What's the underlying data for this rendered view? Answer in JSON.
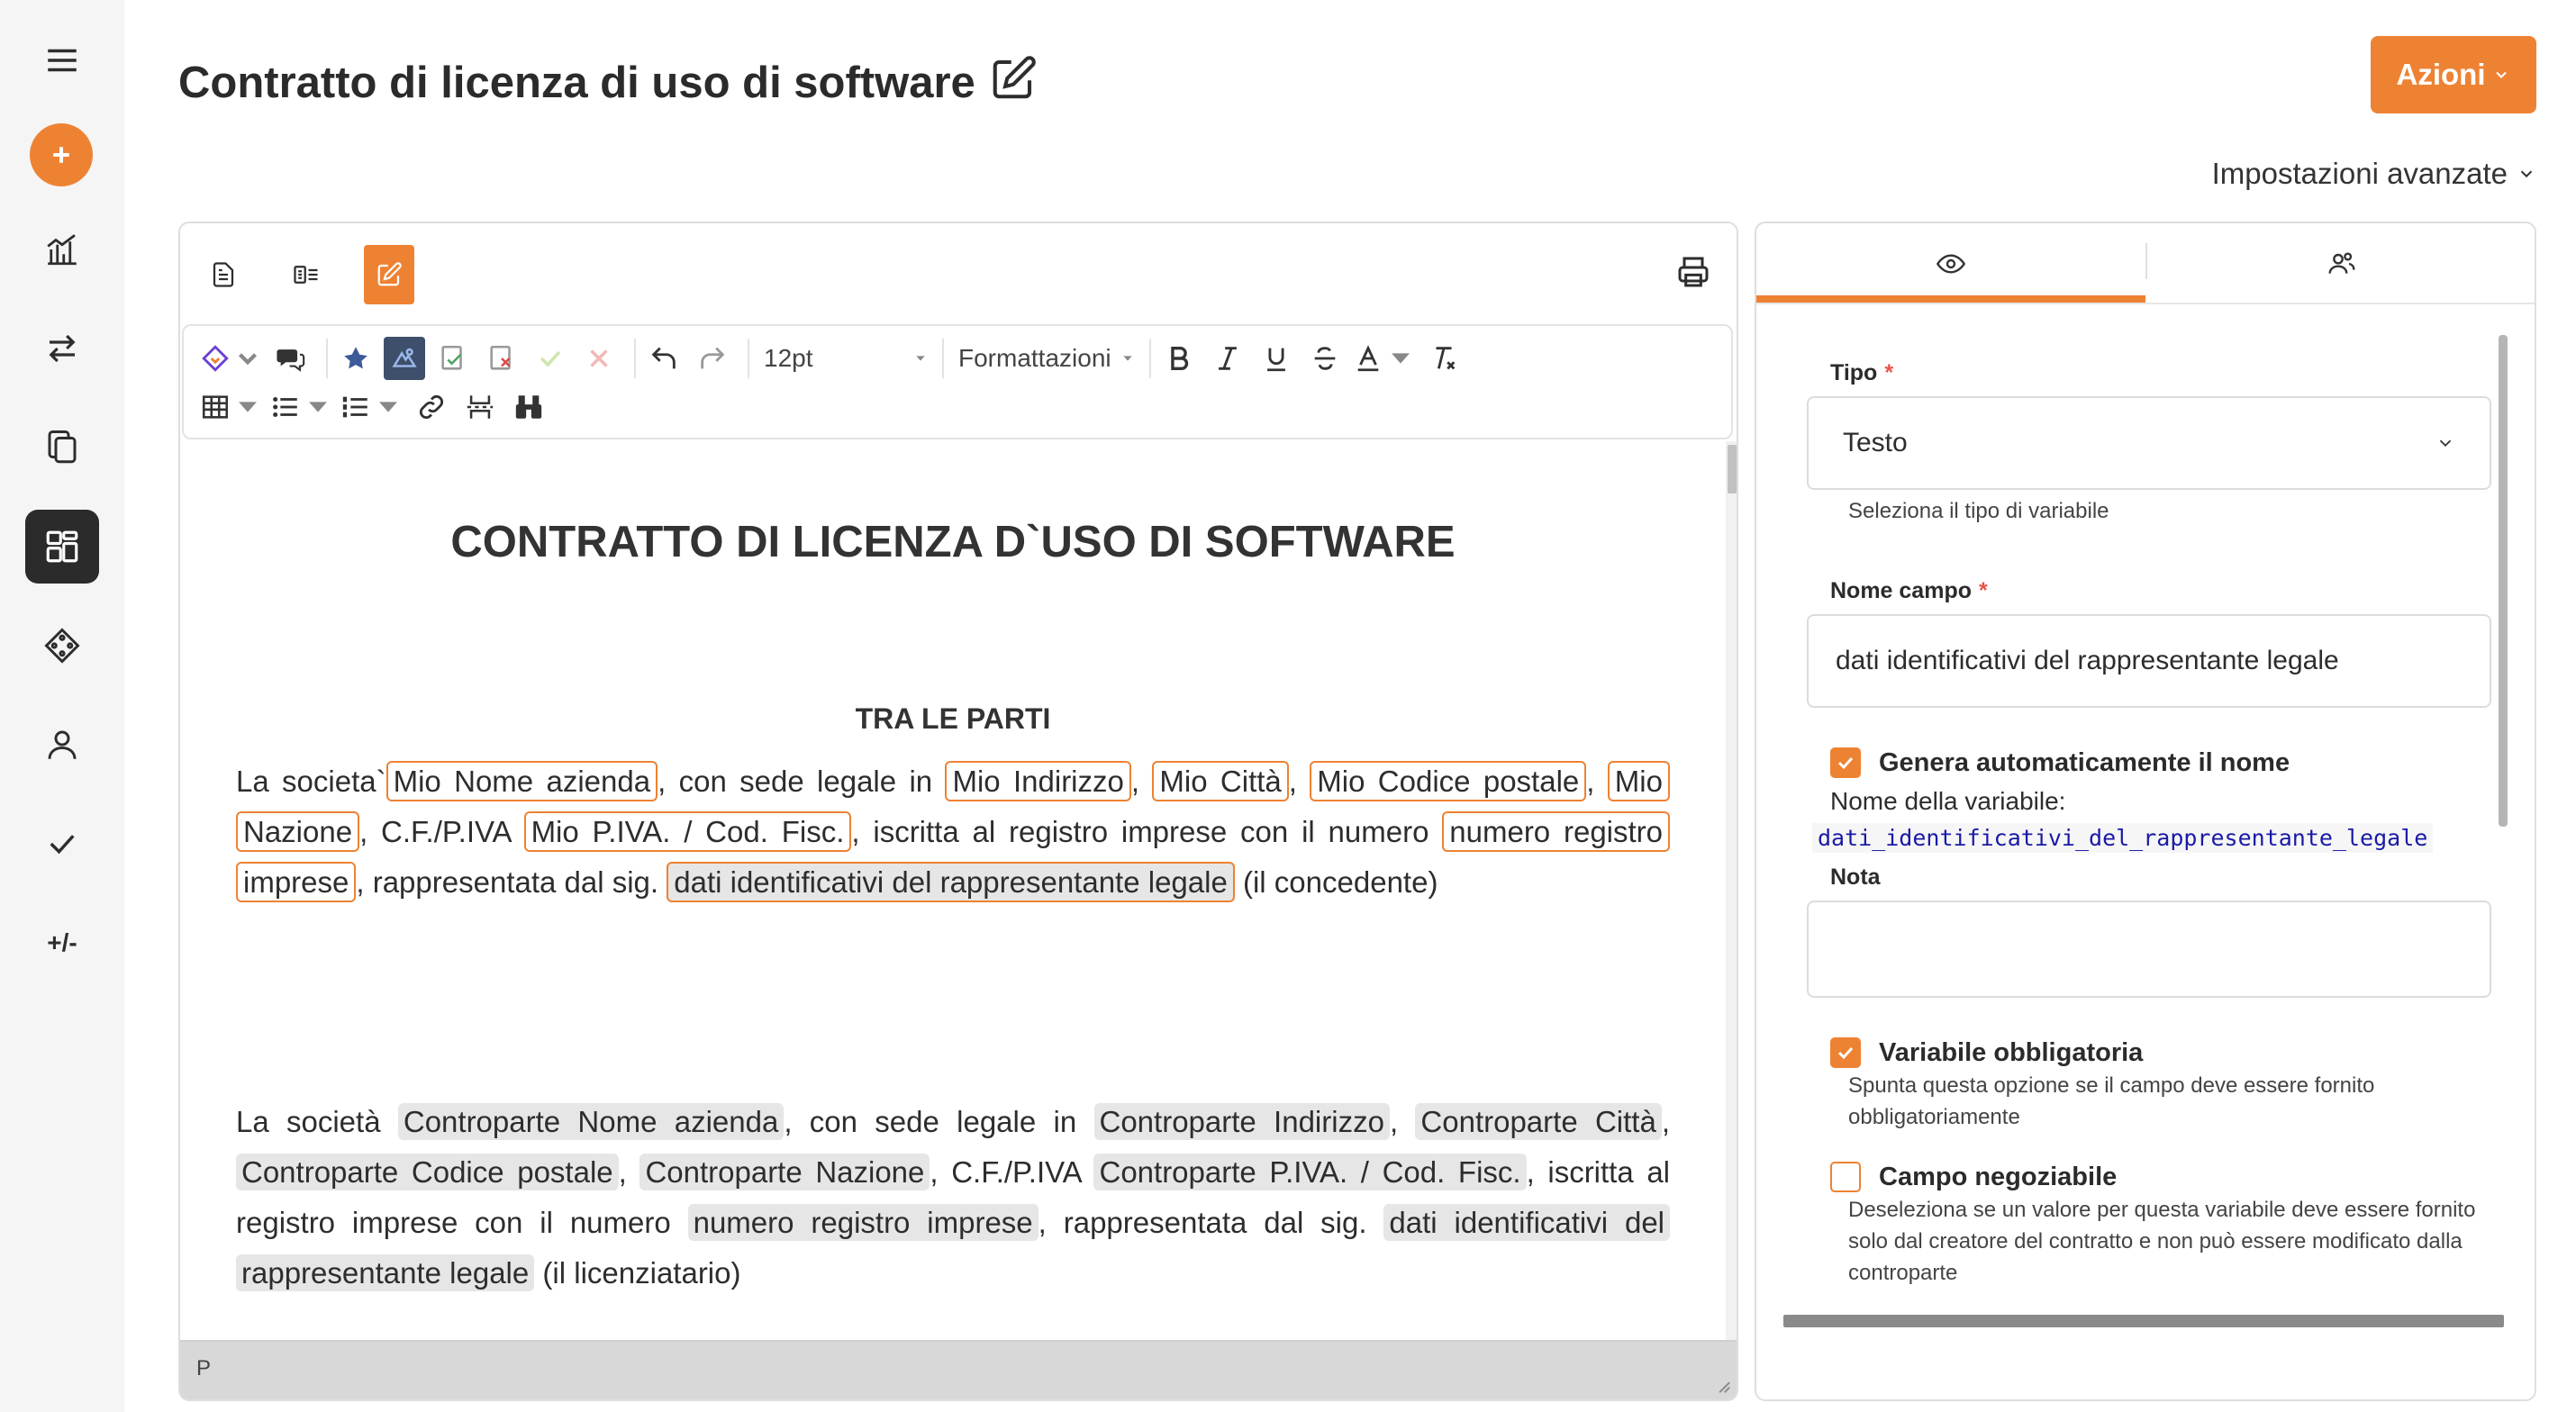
{
  "header": {
    "title": "Contratto di licenza di uso di software",
    "actions_label": "Azioni",
    "advanced_settings_label": "Impostazioni avanzate"
  },
  "sidebar": {
    "items": [
      {
        "name": "menu-icon"
      },
      {
        "name": "add-icon"
      },
      {
        "name": "chart-icon"
      },
      {
        "name": "transfer-icon"
      },
      {
        "name": "copy-icon"
      },
      {
        "name": "dashboard-icon",
        "active": true
      },
      {
        "name": "variables-icon"
      },
      {
        "name": "user-icon"
      },
      {
        "name": "check-icon"
      },
      {
        "name": "plus-minus",
        "text": "+/-"
      }
    ]
  },
  "toolbar": {
    "font_size": "12pt",
    "format_label": "Formattazioni"
  },
  "document": {
    "title": "CONTRATTO DI LICENZA D`USO DI SOFTWARE",
    "subtitle": "TRA LE PARTI",
    "p1": {
      "t1": "La societa`",
      "v1": "Mio Nome azienda",
      "t2": ", con sede legale in ",
      "v2": "Mio Indirizzo",
      "t3": ", ",
      "v3": "Mio Città",
      "t4": ", ",
      "v4": "Mio Codice postale",
      "t5": ", ",
      "v5": "Mio Nazione",
      "t6": ", C.F./P.IVA ",
      "v6": "Mio P.IVA. / Cod. Fisc.",
      "t7": ", iscritta al registro imprese con il numero ",
      "v7": "numero registro imprese",
      "t8": ", rappresentata dal sig. ",
      "v8": "dati identificativi del rappresentante legale",
      "t9": " (il concedente)"
    },
    "p2": {
      "t1": "La società ",
      "v1": "Controparte Nome azienda",
      "t2": ", con sede legale in ",
      "v2": "Controparte Indirizzo",
      "t3": ", ",
      "v3": "Controparte Città",
      "t4": ", ",
      "v4": "Controparte Codice postale",
      "t5": ", ",
      "v5": "Controparte Nazione",
      "t6": ", C.F./P.IVA ",
      "v6": "Controparte P.IVA. / Cod. Fisc.",
      "t7": ", iscritta al registro imprese con il numero ",
      "v7": "numero registro imprese",
      "t8": ", rappresentata dal sig. ",
      "v8": "dati identificativi del rappresentante legale",
      "t9": " (il licenziatario)"
    },
    "status_element": "P"
  },
  "panel": {
    "type_label": "Tipo",
    "type_value": "Testo",
    "type_help": "Seleziona il tipo di variabile",
    "field_name_label": "Nome campo",
    "field_name_value": "dati identificativi del rappresentante legale",
    "auto_name_label": "Genera automaticamente il nome",
    "auto_name_checked": true,
    "variable_name_label": "Nome della variabile:",
    "variable_name_value": "dati_identificativi_del_rappresentante_legale",
    "note_label": "Nota",
    "note_value": "",
    "required_label": "Variabile obbligatoria",
    "required_checked": true,
    "required_help": "Spunta questa opzione se il campo deve essere fornito obbligatoriamente",
    "negotiable_label": "Campo negoziabile",
    "negotiable_checked": false,
    "negotiable_help": "Deseleziona se un valore per questa variabile deve essere fornito solo dal creatore del contratto e non può essere modificato dalla controparte"
  },
  "colors": {
    "accent": "#ee8233",
    "sidebar_bg": "#f5f5f5",
    "active_nav": "#2b2b2b",
    "variable_code": "#1a1aa6"
  }
}
